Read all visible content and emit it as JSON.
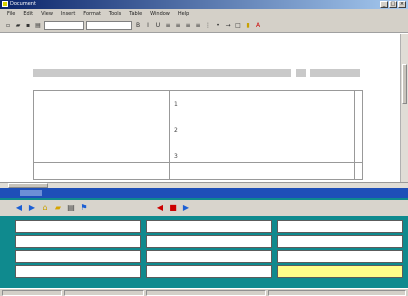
{
  "window": {
    "title": "Document",
    "controls": [
      "_",
      "□",
      "×"
    ]
  },
  "menu": [
    "File",
    "Edit",
    "View",
    "Insert",
    "Format",
    "Tools",
    "Table",
    "Window",
    "Help"
  ],
  "toolbar": {
    "style_value": "",
    "font_value": ""
  },
  "document": {
    "heading": "",
    "lesson_bar": "",
    "table_label": "",
    "marks": [
      "1",
      "2",
      "3"
    ],
    "bottom_text": ""
  },
  "panel": {
    "icon_names": [
      "back-icon",
      "forward-icon",
      "home-icon",
      "folder-icon",
      "print-icon",
      "flag-icon",
      "prev-arrow-icon",
      "stop-icon",
      "next-arrow-icon"
    ],
    "buttons": [
      [
        "",
        "",
        ""
      ],
      [
        "",
        "",
        ""
      ],
      [
        "",
        "",
        ""
      ],
      [
        "",
        "",
        ""
      ]
    ],
    "highlight_button_color": "#fffd8a",
    "panel_color": "#0f8a8e",
    "band_color": "#1e4fb8"
  }
}
